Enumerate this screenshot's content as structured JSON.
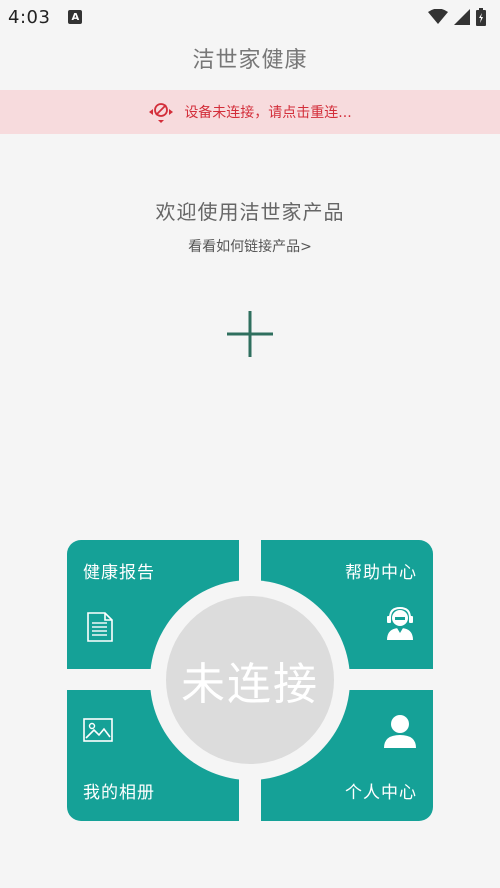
{
  "status_bar": {
    "time": "4:03",
    "notification_icon": "a-badge-icon",
    "right_icons": [
      "wifi-icon",
      "cellular-icon",
      "battery-icon"
    ]
  },
  "header": {
    "title": "洁世家健康"
  },
  "banner": {
    "icon": "disconnected-icon",
    "text": "设备未连接，请点击重连..."
  },
  "welcome": {
    "title": "欢迎使用洁世家产品",
    "howto_link": "看看如何链接产品>"
  },
  "add_button": {
    "icon": "plus-icon"
  },
  "tiles": {
    "health_report": {
      "label": "健康报告",
      "icon": "document-icon"
    },
    "help_center": {
      "label": "帮助中心",
      "icon": "support-agent-icon"
    },
    "my_album": {
      "label": "我的相册",
      "icon": "image-icon"
    },
    "personal_center": {
      "label": "个人中心",
      "icon": "user-icon"
    }
  },
  "connection_status": {
    "label": "未连接"
  },
  "colors": {
    "accent": "#15a197",
    "banner_bg": "#f7dbdd",
    "banner_text": "#d32e3a",
    "background": "#f5f5f5",
    "status_circle": "#dcdcdc"
  }
}
